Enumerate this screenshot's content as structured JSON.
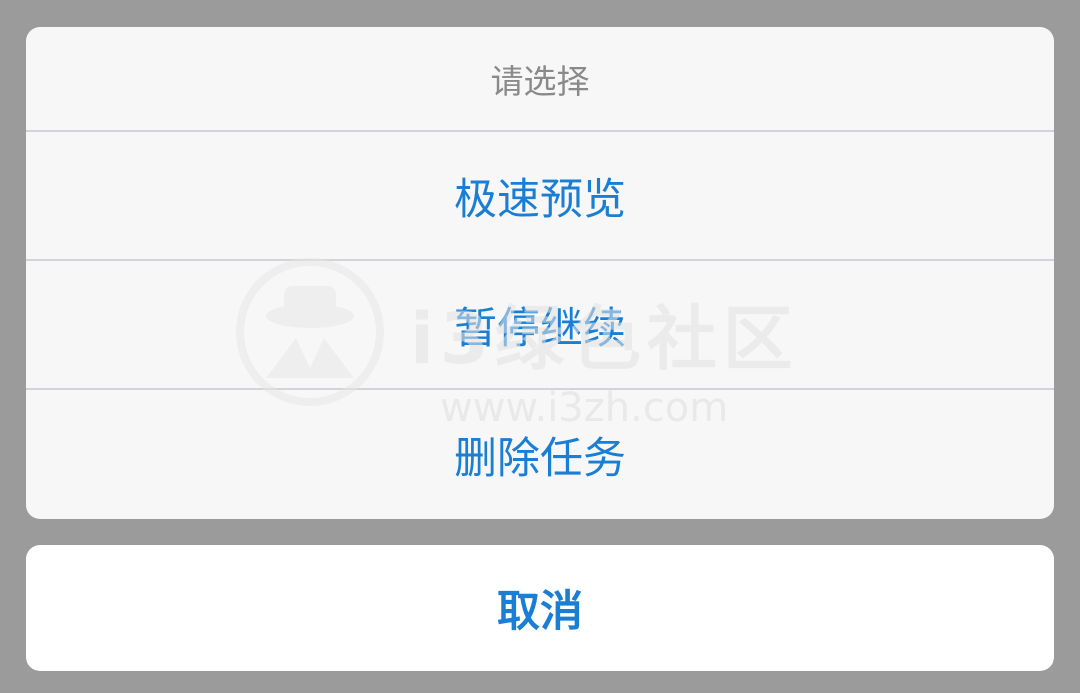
{
  "action_sheet": {
    "title": "请选择",
    "actions": [
      {
        "label": "极速预览"
      },
      {
        "label": "暂停继续"
      },
      {
        "label": "删除任务"
      }
    ],
    "cancel_label": "取消"
  },
  "watermark": {
    "brand": "i3绿色社区",
    "url": "www.i3zh.com"
  },
  "colors": {
    "accent": "#1a7fd4",
    "overlay": "#9b9b9b",
    "sheet_bg": "#f7f7f7",
    "title_text": "#8a8a8a"
  }
}
